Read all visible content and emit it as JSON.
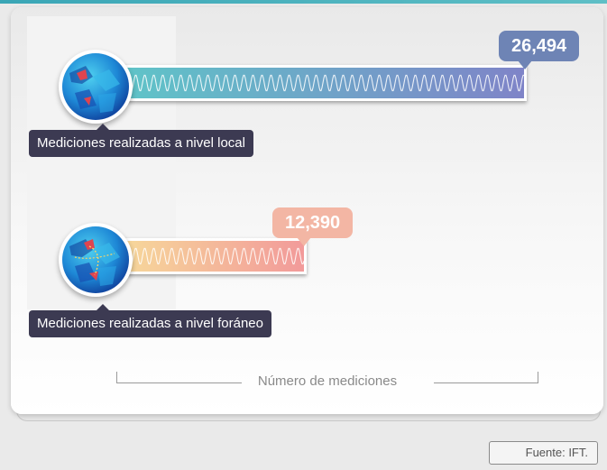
{
  "chart_data": {
    "type": "bar",
    "orientation": "horizontal",
    "categories": [
      "Mediciones realizadas a nivel local",
      "Mediciones realizadas a nivel foráneo"
    ],
    "values": [
      26494,
      12390
    ],
    "value_labels": [
      "26,494",
      "12,390"
    ],
    "xlabel": "Número de mediciones",
    "colors": {
      "local": [
        "#5ec6c8",
        "#7f84c8"
      ],
      "foraneo": [
        "#f7dc9a",
        "#f29a9a"
      ],
      "local_badge": "#6e84b5",
      "foraneo_badge": "#f3b6a4",
      "label_bg": "#3c3a52"
    },
    "icons": [
      "globe-icon",
      "globe-icon"
    ],
    "grid": false
  },
  "source": "Fuente: IFT."
}
